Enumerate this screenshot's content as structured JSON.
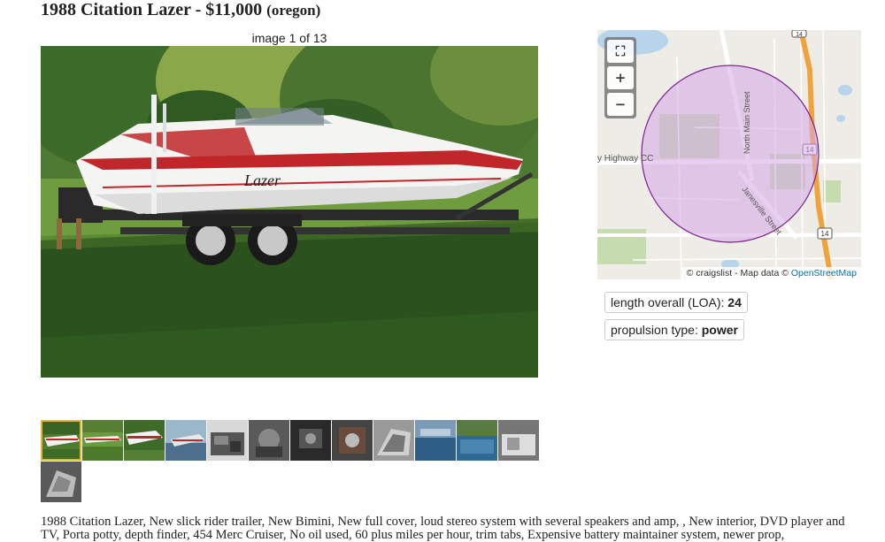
{
  "posting": {
    "title": "1988 Citation Lazer - $11,000",
    "location": "(oregon)",
    "image_counter": "image 1 of 13",
    "description": "1988 Citation Lazer, New slick rider trailer, New Bimini, New full cover, loud stereo system with several speakers and amp, , New interior, DVD player and TV, Porta potty, depth finder, 454 Merc Cruiser, No oil used, 60 plus miles per hour, trim tabs, Expensive battery maintainer system, newer prop,"
  },
  "photo": {
    "boat_decal": "Lazer",
    "thumbnail_count": 13,
    "selected_thumbnail": 1
  },
  "map": {
    "attribution_prefix": "© craigslist - Map data ©",
    "attribution_link": "OpenStreetMap",
    "labels": {
      "highway": "y Highway CC",
      "north_main": "North Main Street",
      "janesville": "Janesville Street",
      "route_top": "14",
      "route_mid": "14",
      "route_bottom": "14"
    },
    "controls": {
      "fullscreen": "⛶",
      "zoom_in": "+",
      "zoom_out": "−"
    },
    "colors": {
      "circle_fill": "#d6a8e6",
      "circle_stroke": "#7a1f8f",
      "highway": "#f0a33c"
    }
  },
  "attributes": [
    {
      "label": "length overall (LOA): ",
      "value": "24"
    },
    {
      "label": "propulsion type: ",
      "value": "power"
    }
  ]
}
